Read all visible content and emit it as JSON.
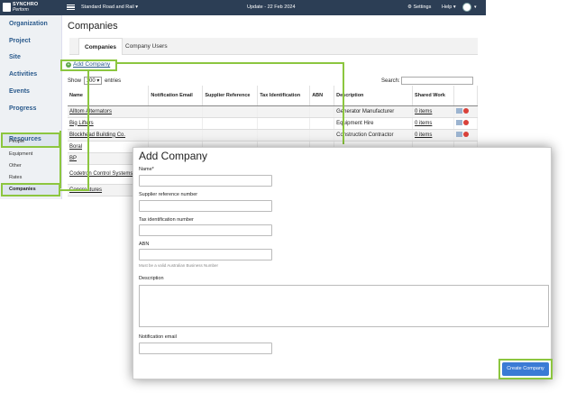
{
  "topbar": {
    "logo_line1": "SYNCHRO",
    "logo_line2": "Perform",
    "project": "Standard Road and Rail ▾",
    "update": "Update - 22 Feb 2024",
    "settings": "⚙ Settings",
    "help": "Help ▾",
    "avatar_dropdown": "▾"
  },
  "sidebar": {
    "items": [
      "Organization",
      "Project",
      "Site",
      "Activities",
      "Events",
      "Progress",
      "Resources"
    ],
    "sub_items": [
      "People",
      "Equipment",
      "Other",
      "Rates",
      "Companies"
    ]
  },
  "main": {
    "title": "Companies",
    "tabs": [
      "Companies",
      "Company Users"
    ],
    "add_company": "Add Company",
    "show_label": "Show",
    "show_value": "100 ▾",
    "entries_label": "entries",
    "search_label": "Search:",
    "columns": [
      "Name",
      "Notification Email",
      "Supplier Reference",
      "Tax Identification",
      "ABN",
      "Description",
      "Shared Work"
    ],
    "rows": [
      {
        "name": "Alltom Alternators",
        "description": "Generator Manufacturer",
        "shared": "0 items"
      },
      {
        "name": "Big Lifters",
        "description": "Equipment Hire",
        "shared": "0 items"
      },
      {
        "name": "Blockhead Building Co.",
        "description": "Construction Contractor",
        "shared": "0 items"
      },
      {
        "name": "Boral",
        "description": "",
        "shared": ""
      },
      {
        "name": "BP",
        "description": "",
        "shared": ""
      },
      {
        "name": "Codetron Control Systems",
        "description": "",
        "shared": ""
      },
      {
        "name": "Concreatures",
        "description": "",
        "shared": ""
      }
    ]
  },
  "modal": {
    "title": "Add Company",
    "name_label": "Name*",
    "supplier_label": "Supplier reference number",
    "tax_label": "Tax identification number",
    "abn_label": "ABN",
    "abn_hint": "Must be a valid Australian Business Number",
    "description_label": "Description",
    "notification_label": "Notification email",
    "create_button": "Create Company"
  }
}
